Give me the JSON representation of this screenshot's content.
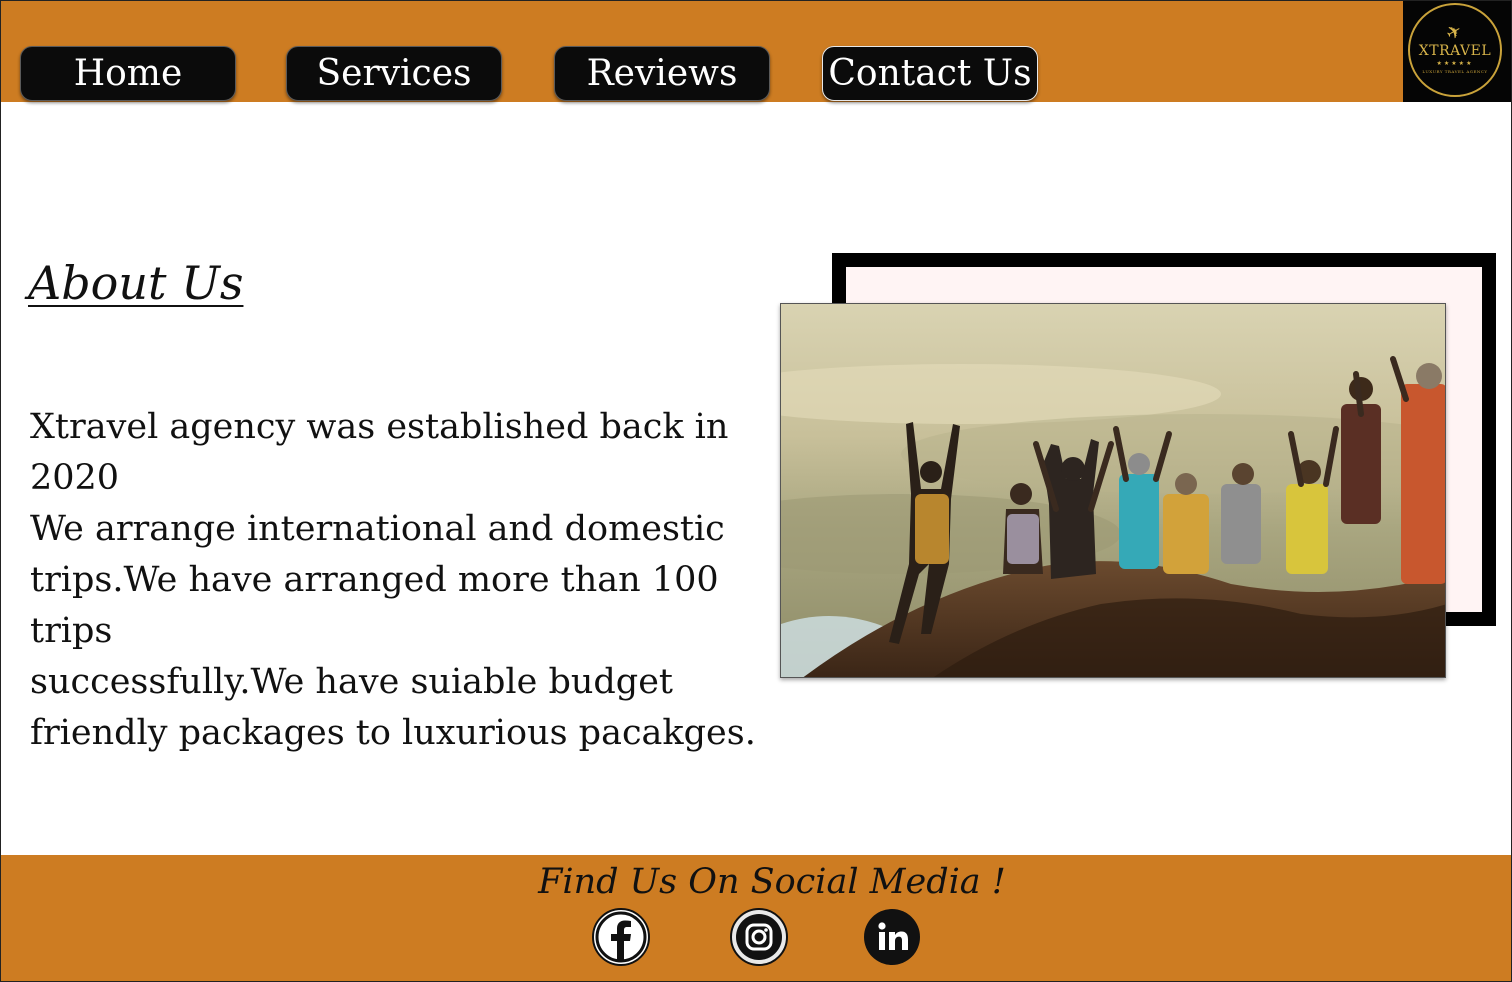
{
  "nav": {
    "items": [
      {
        "label": "Home"
      },
      {
        "label": "Services"
      },
      {
        "label": "Reviews"
      },
      {
        "label": "Contact Us"
      }
    ]
  },
  "logo": {
    "brand": "XTRAVEL",
    "stars": "★★★★★",
    "tagline": "LUXURY TRAVEL AGENCY"
  },
  "about": {
    "title": "About Us",
    "lines": [
      "Xtravel agency was established back in 2020",
      "We arrange international and domestic",
      "trips.We have arranged more than 100 trips",
      "successfully.We have suiable budget",
      "friendly packages to luxurious pacakges."
    ]
  },
  "footer": {
    "title": "Find Us On Social Media !",
    "icons": [
      "facebook-icon",
      "instagram-icon",
      "linkedin-icon"
    ]
  },
  "colors": {
    "brand_orange": "#cd7c22",
    "nav_button": "#0b0b0b",
    "logo_gold": "#d8b44a",
    "photo_frame_bg": "#fff4f4"
  }
}
